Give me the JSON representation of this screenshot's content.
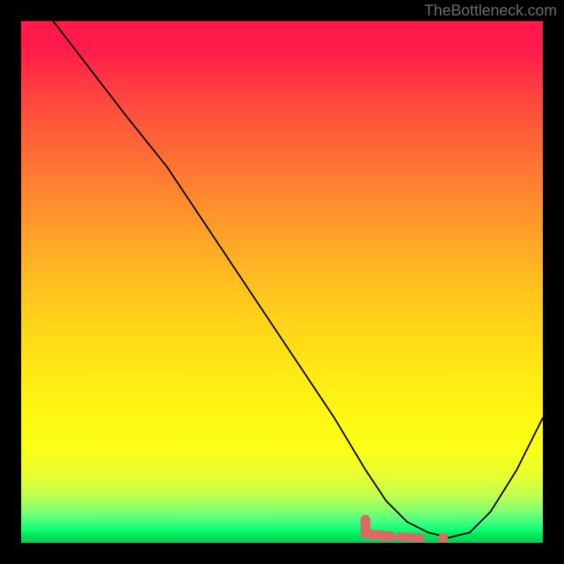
{
  "watermark": "TheBottleneck.com",
  "chart_data": {
    "type": "line",
    "title": "",
    "xlabel": "",
    "ylabel": "",
    "xlim": [
      0,
      100
    ],
    "ylim": [
      0,
      100
    ],
    "gradient_stops": [
      {
        "pos": 0,
        "color": "#ff1a4a"
      },
      {
        "pos": 50,
        "color": "#ffc41e"
      },
      {
        "pos": 85,
        "color": "#fbff18"
      },
      {
        "pos": 97,
        "color": "#10ff70"
      },
      {
        "pos": 100,
        "color": "#00d050"
      }
    ],
    "series": [
      {
        "name": "bottleneck-curve",
        "color": "#000000",
        "x": [
          0,
          20,
          28,
          40,
          52,
          60,
          66,
          70,
          74,
          78,
          82,
          86,
          90,
          95,
          100
        ],
        "values": [
          108,
          82,
          72,
          54,
          36,
          24,
          14,
          8,
          4,
          2,
          1,
          2,
          6,
          14,
          24
        ]
      }
    ],
    "marker_band": {
      "name": "optimal-range",
      "color": "#d86b66",
      "x_start": 66,
      "x_end": 84,
      "y": 2
    }
  }
}
